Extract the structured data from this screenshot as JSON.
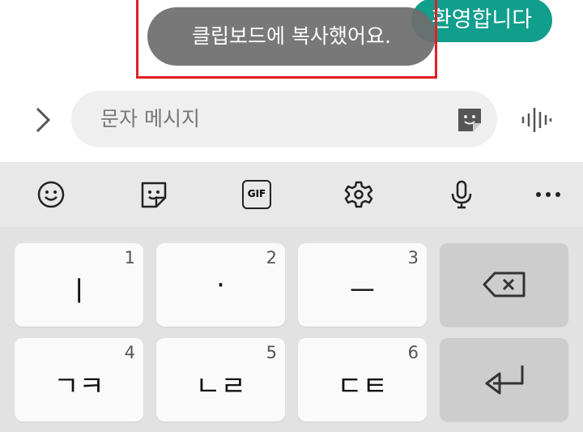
{
  "chat": {
    "greeting": "환영합니다"
  },
  "toast": {
    "text": "클립보드에 복사했어요."
  },
  "input": {
    "placeholder": "문자 메시지"
  },
  "toolbar": {
    "icons": [
      "emoji-icon",
      "sticker-icon",
      "gif-icon",
      "settings-icon",
      "microphone-icon",
      "more-icon"
    ],
    "gif_label": "GIF"
  },
  "keys": [
    {
      "glyph": "ㅣ",
      "num": "1"
    },
    {
      "glyph": "·",
      "num": "2"
    },
    {
      "glyph": "ㅡ",
      "num": "3"
    },
    {
      "glyph": "ㄱㅋ",
      "num": "4"
    },
    {
      "glyph": "ㄴㄹ",
      "num": "5"
    },
    {
      "glyph": "ㄷㅌ",
      "num": "6"
    }
  ],
  "colors": {
    "accent": "#119e8c",
    "highlight": "#e41e26"
  }
}
